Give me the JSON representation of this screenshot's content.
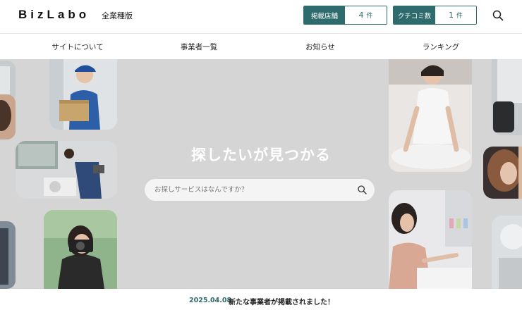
{
  "header": {
    "logo": "BizLabo",
    "edition": "全業種版",
    "stats": {
      "shops": {
        "label": "掲載店舗",
        "value": "4",
        "unit": "件"
      },
      "reviews": {
        "label": "クチコミ数",
        "value": "1",
        "unit": "件"
      }
    },
    "search_icon": "search-icon"
  },
  "nav": {
    "items": [
      {
        "label": "サイトについて"
      },
      {
        "label": "事業者一覧"
      },
      {
        "label": "お知らせ"
      },
      {
        "label": "ランキング"
      }
    ]
  },
  "hero": {
    "title": "探したいが見つかる",
    "search": {
      "placeholder": "お探しサービスはなんですか？",
      "icon": "search-icon"
    },
    "photos": [
      {
        "name": "photo-delivery-worker"
      },
      {
        "name": "photo-aircon-technician"
      },
      {
        "name": "photo-camera-woman"
      },
      {
        "name": "photo-massage-therapist"
      },
      {
        "name": "photo-nail-artist"
      },
      {
        "name": "photo-hair-stylist"
      },
      {
        "name": "photo-office-chair"
      }
    ]
  },
  "news": {
    "date": "2025.04.08",
    "text": "新たな事業者が掲載されました！"
  },
  "colors": {
    "accent": "#2d6b6d",
    "hero_bg": "#d5d5d5",
    "white": "#ffffff"
  }
}
